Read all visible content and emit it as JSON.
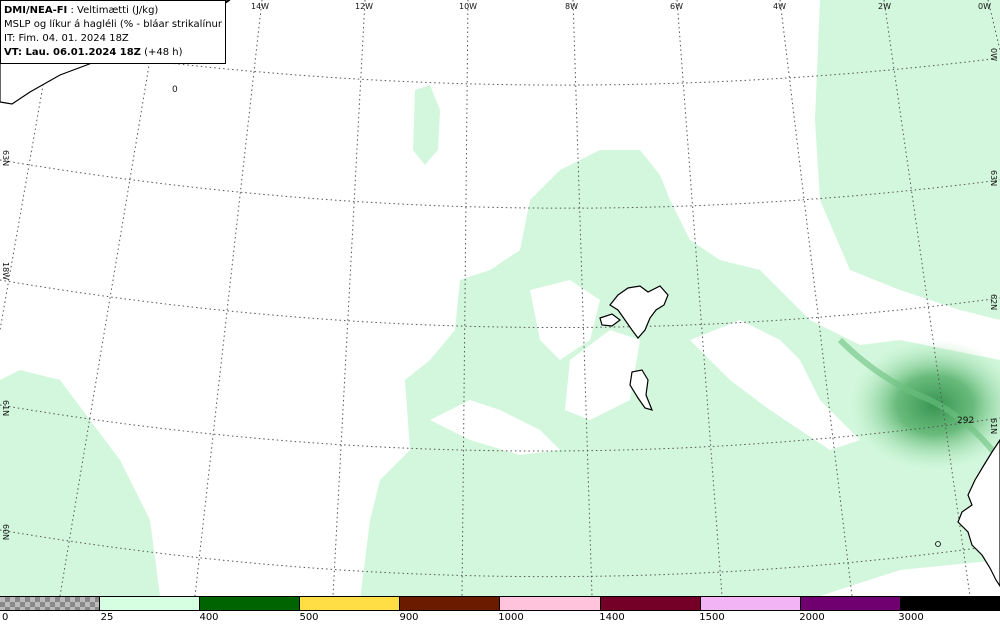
{
  "info_panel": {
    "model": "DMI/NEA-FI",
    "field": " : Veltimætti (J/kg)",
    "overlay": "MSLP og líkur á hagléli (% - bláar strikalínur)",
    "init_time": "IT: Fim. 04. 01. 2024 18Z",
    "valid_prefix": "VT: Lau. 06.01.2024 18Z",
    "valid_suffix": " (+48 h)"
  },
  "longitude_labels": [
    "14W",
    "12W",
    "10W",
    "8W",
    "6W",
    "4W",
    "2W",
    "0W"
  ],
  "latitude_labels_left": [
    "63N",
    "18W",
    "61N",
    "60N"
  ],
  "latitude_labels_right": [
    "0W",
    "63N",
    "62N",
    "61N"
  ],
  "field_values": [
    "0",
    "292"
  ],
  "legend": {
    "colors": [
      "checker",
      "#d6ffe2",
      "#006400",
      "#ffdd44",
      "#6b1c00",
      "#ffc4dc",
      "#740028",
      "#f2b4f4",
      "#700070",
      "#000000"
    ],
    "ticks": [
      "0",
      "25",
      "400",
      "500",
      "900",
      "1000",
      "1400",
      "1500",
      "2000",
      "3000"
    ]
  }
}
